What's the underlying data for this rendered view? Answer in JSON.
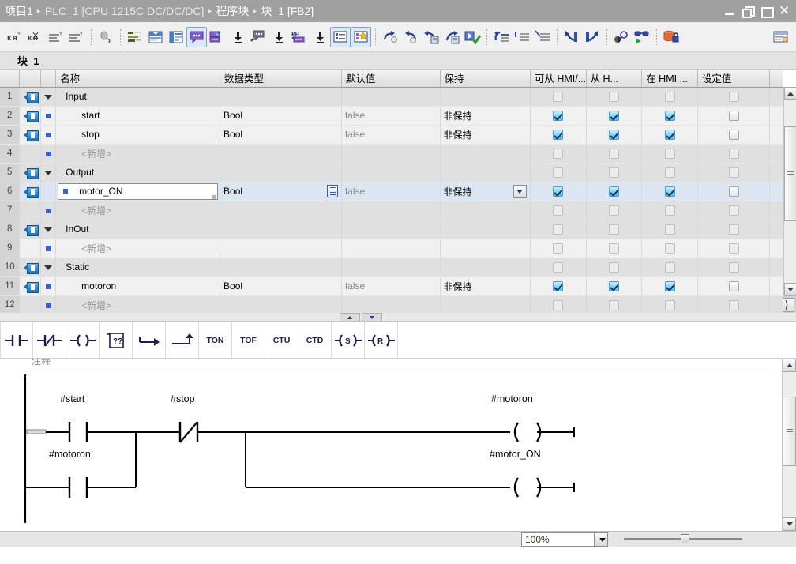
{
  "titlebar": {
    "crumbs": [
      "项目1",
      "PLC_1 [CPU 1215C DC/DC/DC]",
      "程序块",
      "块_1 [FB2]"
    ],
    "separator": "▸",
    "buttons": {
      "minimize": "minimize",
      "restore": "restore",
      "maximize": "maximize",
      "close": "✕"
    }
  },
  "toolbar": {
    "items": [
      {
        "name": "insert-row-before-icon",
        "label": ""
      },
      {
        "name": "insert-row-after-icon",
        "label": ""
      },
      {
        "name": "add-row-icon",
        "label": ""
      },
      {
        "name": "add-row-below-icon",
        "label": ""
      },
      {
        "name": "undo-icon",
        "label": ""
      },
      {
        "name": "show-all-columns-icon",
        "label": ""
      },
      {
        "name": "optimize-width-icon",
        "label": ""
      },
      {
        "name": "fit-columns-icon",
        "label": ""
      },
      {
        "name": "show-comments-icon",
        "label": "",
        "active": true
      },
      {
        "name": "network-comment-icon",
        "label": ""
      },
      {
        "name": "comment-block-icon",
        "label": ""
      },
      {
        "name": "absolute-symbolic-icon",
        "label": ""
      },
      {
        "name": "layout-list-icon",
        "label": "",
        "active": true
      },
      {
        "name": "favorites-icon",
        "label": "",
        "active": true
      },
      {
        "name": "redo-step-icon",
        "label": ""
      },
      {
        "name": "undo-step-icon",
        "label": ""
      },
      {
        "name": "download-block-icon",
        "label": ""
      },
      {
        "name": "upload-block-icon",
        "label": ""
      },
      {
        "name": "compile-ok-icon",
        "label": ""
      },
      {
        "name": "goto-network-icon",
        "label": ""
      },
      {
        "name": "goto-first-icon",
        "label": ""
      },
      {
        "name": "goto-last-icon",
        "label": ""
      },
      {
        "name": "go-back-icon",
        "label": ""
      },
      {
        "name": "go-forward-icon",
        "label": ""
      },
      {
        "name": "monitor-search-icon",
        "label": ""
      },
      {
        "name": "monitoring-glasses-icon",
        "label": ""
      },
      {
        "name": "protect-block-icon",
        "label": ""
      },
      {
        "name": "properties-icon",
        "label": ""
      }
    ]
  },
  "block": {
    "name": "块_1"
  },
  "interface_table": {
    "columns": [
      {
        "key": "num",
        "label": ""
      },
      {
        "key": "ico",
        "label": ""
      },
      {
        "key": "dot",
        "label": ""
      },
      {
        "key": "name",
        "label": "名称"
      },
      {
        "key": "type",
        "label": "数据类型"
      },
      {
        "key": "def",
        "label": "默认值"
      },
      {
        "key": "ret",
        "label": "保持"
      },
      {
        "key": "hmi1",
        "label": "可从 HMI/..."
      },
      {
        "key": "hmi2",
        "label": "从 H..."
      },
      {
        "key": "hmi3",
        "label": "在 HMI ..."
      },
      {
        "key": "setp",
        "label": "设定值"
      }
    ],
    "rows": [
      {
        "num": "1",
        "kind": "group",
        "tag": true,
        "name": "Input",
        "type": "",
        "def": "",
        "ret": "",
        "hmi1": false,
        "hmi2": false,
        "hmi3": false,
        "setp": false,
        "shade": "alt"
      },
      {
        "num": "2",
        "kind": "item",
        "tag": true,
        "name": "start",
        "type": "Bool",
        "def": "false",
        "ret": "非保持",
        "hmi1": true,
        "hmi2": true,
        "hmi3": true,
        "setp": false,
        "shade": "norm"
      },
      {
        "num": "3",
        "kind": "item",
        "tag": true,
        "name": "stop",
        "type": "Bool",
        "def": "false",
        "ret": "非保持",
        "hmi1": true,
        "hmi2": true,
        "hmi3": true,
        "setp": false,
        "shade": "norm"
      },
      {
        "num": "4",
        "kind": "new",
        "tag": false,
        "name": "<新增>",
        "type": "",
        "def": "",
        "ret": "",
        "hmi1": false,
        "hmi2": false,
        "hmi3": false,
        "setp": false,
        "shade": "alt"
      },
      {
        "num": "5",
        "kind": "group",
        "tag": true,
        "name": "Output",
        "type": "",
        "def": "",
        "ret": "",
        "hmi1": false,
        "hmi2": false,
        "hmi3": false,
        "setp": false,
        "shade": "alt"
      },
      {
        "num": "6",
        "kind": "item",
        "tag": true,
        "name": "motor_ON",
        "type": "Bool",
        "def": "false",
        "ret": "非保持",
        "hmi1": true,
        "hmi2": true,
        "hmi3": true,
        "setp": false,
        "shade": "sel",
        "editing": true
      },
      {
        "num": "7",
        "kind": "new",
        "tag": false,
        "name": "<新增>",
        "type": "",
        "def": "",
        "ret": "",
        "hmi1": false,
        "hmi2": false,
        "hmi3": false,
        "setp": false,
        "shade": "alt"
      },
      {
        "num": "8",
        "kind": "group",
        "tag": true,
        "name": "InOut",
        "type": "",
        "def": "",
        "ret": "",
        "hmi1": false,
        "hmi2": false,
        "hmi3": false,
        "setp": false,
        "shade": "alt"
      },
      {
        "num": "9",
        "kind": "new",
        "tag": false,
        "name": "<新增>",
        "type": "",
        "def": "",
        "ret": "",
        "hmi1": false,
        "hmi2": false,
        "hmi3": false,
        "setp": false,
        "shade": "norm"
      },
      {
        "num": "10",
        "kind": "group",
        "tag": true,
        "name": "Static",
        "type": "",
        "def": "",
        "ret": "",
        "hmi1": false,
        "hmi2": false,
        "hmi3": false,
        "setp": false,
        "shade": "alt"
      },
      {
        "num": "11",
        "kind": "item",
        "tag": true,
        "name": "motoron",
        "type": "Bool",
        "def": "false",
        "ret": "非保持",
        "hmi1": true,
        "hmi2": true,
        "hmi3": true,
        "setp": false,
        "shade": "norm"
      },
      {
        "num": "12",
        "kind": "new",
        "tag": false,
        "name": "<新增>",
        "type": "",
        "def": "",
        "ret": "",
        "hmi1": false,
        "hmi2": false,
        "hmi3": false,
        "setp": false,
        "shade": "alt"
      }
    ]
  },
  "lad_toolbar": {
    "items": [
      {
        "name": "no-contact-icon",
        "label": ""
      },
      {
        "name": "nc-contact-icon",
        "label": ""
      },
      {
        "name": "coil-icon",
        "label": ""
      },
      {
        "name": "empty-box-icon",
        "label": "??"
      },
      {
        "name": "jump-icon",
        "label": ""
      },
      {
        "name": "jump-label-icon",
        "label": ""
      },
      {
        "name": "ton-timer-button",
        "label": "TON"
      },
      {
        "name": "tof-timer-button",
        "label": "TOF"
      },
      {
        "name": "ctu-counter-button",
        "label": "CTU"
      },
      {
        "name": "ctd-counter-button",
        "label": "CTD"
      },
      {
        "name": "set-coil-icon",
        "label": "S"
      },
      {
        "name": "reset-coil-icon",
        "label": "R"
      }
    ]
  },
  "network": {
    "title": "注释",
    "rungs": {
      "contacts": [
        {
          "label": "#start",
          "type": "no",
          "branch": "main"
        },
        {
          "label": "#stop",
          "type": "nc",
          "branch": "main"
        },
        {
          "label": "#motoron",
          "type": "no",
          "branch": "parallel"
        }
      ],
      "coils": [
        {
          "label": "#motoron",
          "type": "coil"
        },
        {
          "label": "#motor_ON",
          "type": "coil"
        }
      ]
    }
  },
  "statusbar": {
    "zoom": "100%"
  },
  "colors": {
    "title_bg": "#a0a0a0",
    "accent_blue": "#1b6fb5",
    "check_cyan": "#3fc3ef",
    "selection": "#dce6f2",
    "lad_ink": "#1d1d4e"
  }
}
